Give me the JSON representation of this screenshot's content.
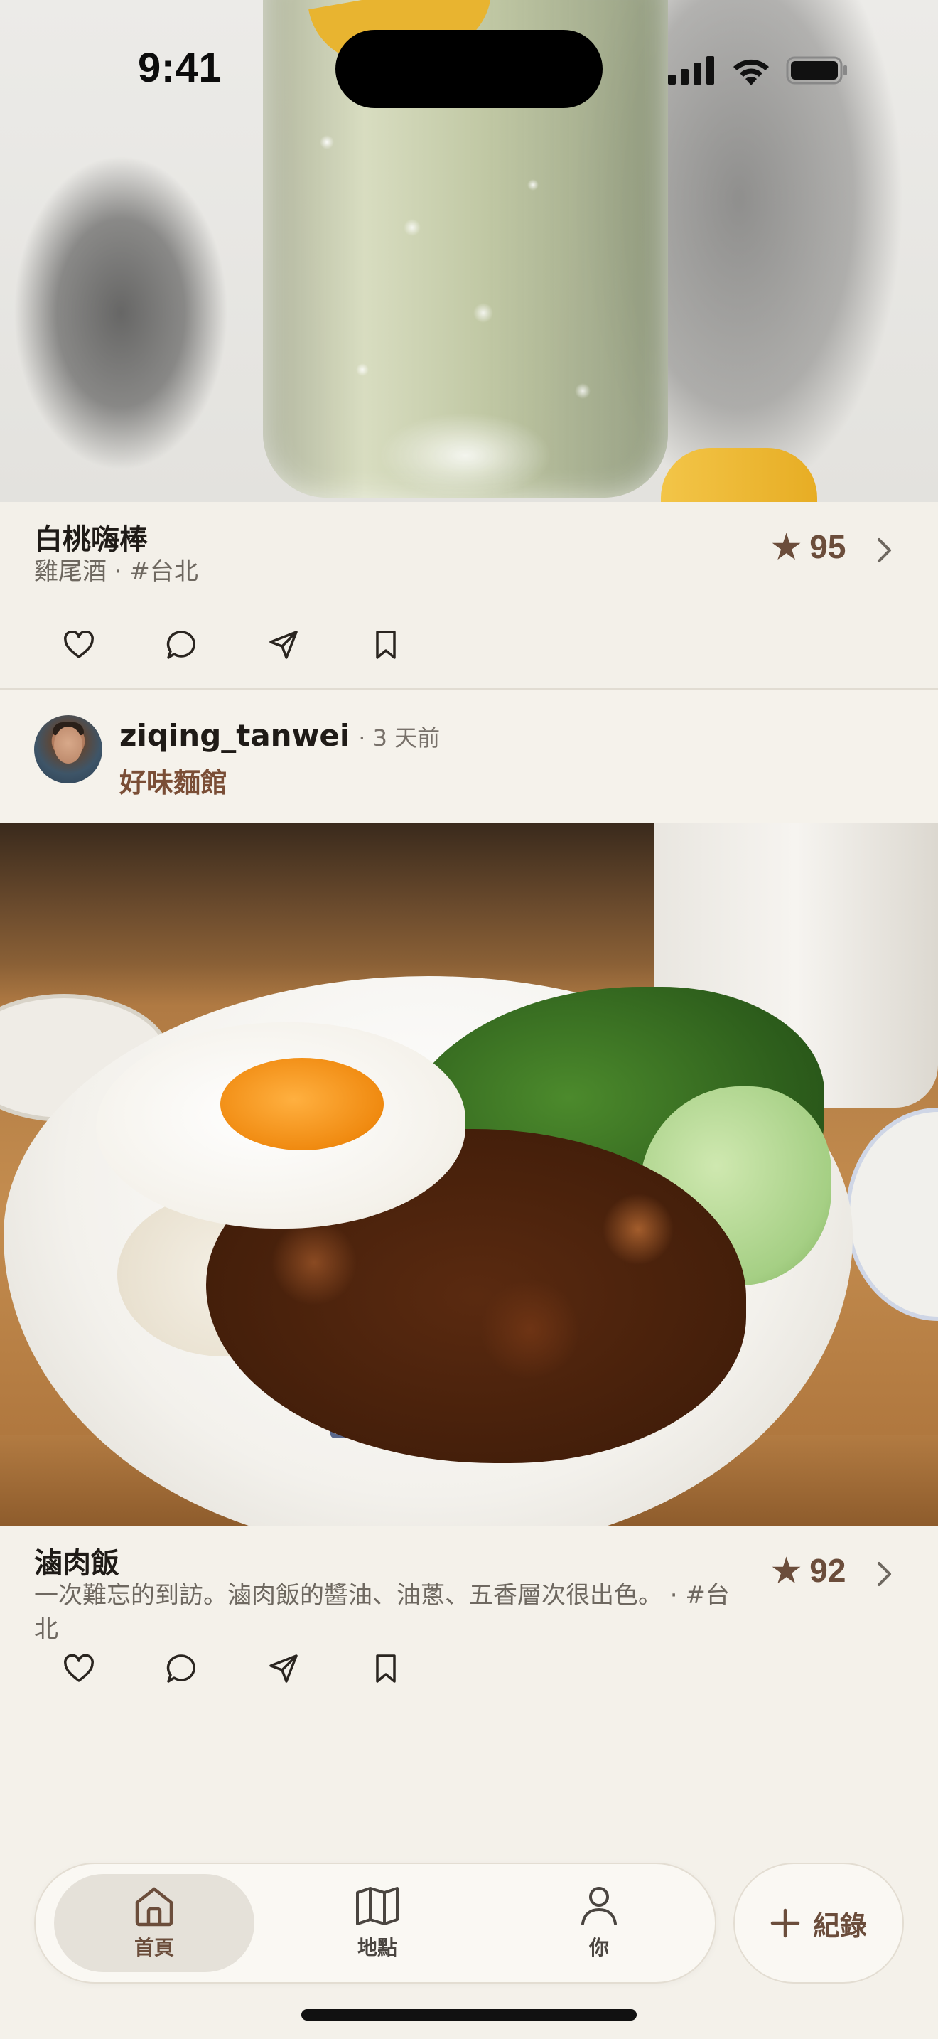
{
  "status_bar": {
    "time": "9:41"
  },
  "posts": [
    {
      "title": "白桃嗨棒",
      "subtitle": "雞尾酒 · #台北",
      "score": "95",
      "photo_icon": "highball-drink-photo"
    },
    {
      "author": "ziqing_tanwei",
      "time_ago": "· 3 天前",
      "restaurant": "好味麵館",
      "title": "滷肉飯",
      "subtitle": "一次難忘的到訪。滷肉飯的醬油、油蔥、五香層次很出色。 · #台北",
      "score": "92",
      "photo_icon": "braised-pork-rice-photo"
    }
  ],
  "actions": [
    "heart-icon",
    "comment-icon",
    "send-icon",
    "bookmark-icon"
  ],
  "tab_bar": {
    "items": [
      {
        "label": "首頁",
        "icon": "home-icon",
        "active": true
      },
      {
        "label": "地點",
        "icon": "map-icon",
        "active": false
      },
      {
        "label": "你",
        "icon": "person-icon",
        "active": false
      }
    ],
    "record_label": "紀錄"
  },
  "colors": {
    "background": "#f4f1ea",
    "accent_brown": "#6b4d3b",
    "restaurant_brown": "#7a4e36",
    "active_tab": "#e5e1d9"
  }
}
